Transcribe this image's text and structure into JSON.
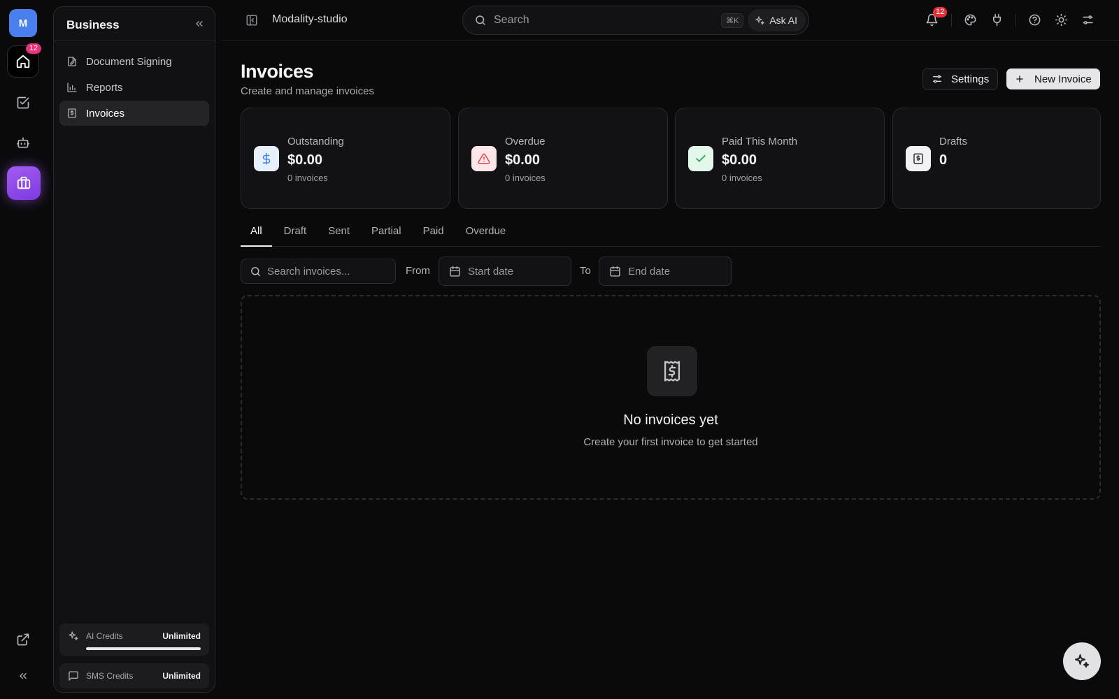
{
  "rail": {
    "avatar_letter": "M",
    "home_badge": "12",
    "icons": [
      "home-icon",
      "tasks-icon",
      "bot-icon",
      "briefcase-icon",
      "external-link-icon",
      "chevrons-left-icon"
    ],
    "accent_color": "#8b45e8"
  },
  "sidebar": {
    "title": "Business",
    "items": [
      {
        "label": "Document Signing",
        "icon": "file-signature-icon"
      },
      {
        "label": "Reports",
        "icon": "bar-chart-icon"
      },
      {
        "label": "Invoices",
        "icon": "receipt-icon",
        "active": true
      }
    ],
    "ai_credits": {
      "label": "AI Credits",
      "value": "Unlimited",
      "usage_fraction": 1.0
    },
    "sms_credits": {
      "label": "SMS Credits",
      "value": "Unlimited"
    }
  },
  "topbar": {
    "workspace": "Modality-studio",
    "search_placeholder": "Search",
    "shortcut": "⌘K",
    "ask_ai": "Ask AI",
    "notification_badge": "12",
    "icons": [
      "bell-icon",
      "palette-icon",
      "plug-icon",
      "help-icon",
      "sun-icon",
      "sliders-icon"
    ]
  },
  "page": {
    "title": "Invoices",
    "subtitle": "Create and manage invoices",
    "settings_label": "Settings",
    "new_label": "New Invoice"
  },
  "cards": [
    {
      "label": "Outstanding",
      "value": "$0.00",
      "sub": "0 invoices",
      "icon": "dollar-icon",
      "color": "#3b82f6"
    },
    {
      "label": "Overdue",
      "value": "$0.00",
      "sub": "0 invoices",
      "icon": "alert-triangle-icon",
      "color": "#e5484d"
    },
    {
      "label": "Paid This Month",
      "value": "$0.00",
      "sub": "0 invoices",
      "icon": "check-icon",
      "color": "#22a55b"
    },
    {
      "label": "Drafts",
      "value": "0",
      "icon": "receipt-icon",
      "color": "#333333"
    }
  ],
  "tabs": [
    "All",
    "Draft",
    "Sent",
    "Partial",
    "Paid",
    "Overdue"
  ],
  "active_tab": "All",
  "filters": {
    "search_placeholder": "Search invoices...",
    "from_label": "From",
    "start_placeholder": "Start date",
    "to_label": "To",
    "end_placeholder": "End date"
  },
  "empty": {
    "title": "No invoices yet",
    "subtitle": "Create your first invoice to get started"
  }
}
